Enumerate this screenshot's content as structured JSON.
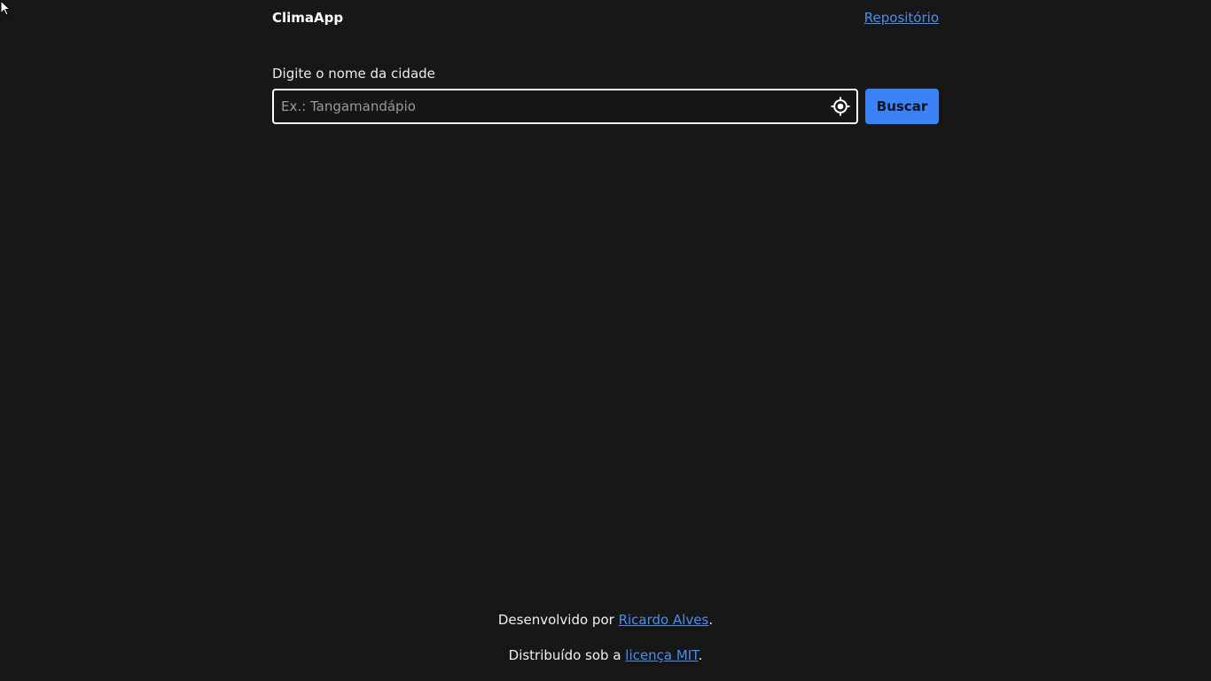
{
  "header": {
    "brand": "ClimaApp",
    "repo_link": "Repositório"
  },
  "search": {
    "label": "Digite o nome da cidade",
    "placeholder": "Ex.: Tangamandápio",
    "value": "",
    "locate_icon": "crosshair-target-icon",
    "button_label": "Buscar"
  },
  "footer": {
    "developed_prefix": "Desenvolvido por",
    "developer_name": "Ricardo Alves",
    "developed_suffix": ".",
    "license_prefix": "Distribuído sob a",
    "license_link": "licença MIT",
    "license_suffix": "."
  },
  "colors": {
    "background": "#171717",
    "accent": "#3b82f6",
    "link": "#4b8df0"
  }
}
